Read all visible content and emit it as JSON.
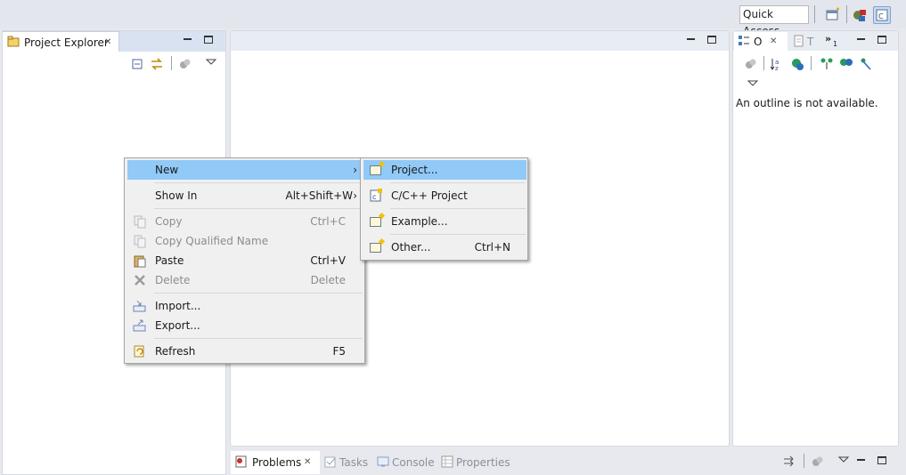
{
  "toolbar": {
    "quick_access": "Quick Access",
    "icons": [
      "open-perspective-icon",
      "debug-perspective-icon",
      "cpp-perspective-icon"
    ]
  },
  "project_explorer": {
    "tab_label": "Project Explorer",
    "icons": [
      "collapse-all-icon",
      "link-with-editor-icon",
      "filters-icon",
      "view-menu-icon"
    ]
  },
  "outline": {
    "tab_short": "O",
    "tab2_short": "T",
    "overflow_count": "1",
    "message": "An outline is not available."
  },
  "bottom_tabs": {
    "problems": "Problems",
    "tasks": "Tasks",
    "console": "Console",
    "properties": "Properties"
  },
  "context_menu": {
    "items": [
      {
        "label": "New",
        "shortcut": "",
        "submenu": true,
        "highlighted": true,
        "enabled": true,
        "icon": ""
      },
      {
        "label": "Show In",
        "shortcut": "Alt+Shift+W",
        "submenu": true,
        "enabled": true,
        "icon": ""
      },
      {
        "label": "Copy",
        "shortcut": "Ctrl+C",
        "enabled": false,
        "icon": "copy-icon"
      },
      {
        "label": "Copy Qualified Name",
        "shortcut": "",
        "enabled": false,
        "icon": "copy-qualified-name-icon"
      },
      {
        "label": "Paste",
        "shortcut": "Ctrl+V",
        "enabled": true,
        "icon": "paste-icon"
      },
      {
        "label": "Delete",
        "shortcut": "Delete",
        "enabled": false,
        "icon": "delete-icon"
      },
      {
        "label": "Import...",
        "shortcut": "",
        "enabled": true,
        "icon": "import-icon"
      },
      {
        "label": "Export...",
        "shortcut": "",
        "enabled": true,
        "icon": "export-icon"
      },
      {
        "label": "Refresh",
        "shortcut": "F5",
        "enabled": true,
        "icon": "refresh-icon"
      }
    ]
  },
  "submenu": {
    "items": [
      {
        "label": "Project...",
        "shortcut": "",
        "highlighted": true,
        "icon": "new-project-icon"
      },
      {
        "label": "C/C++ Project",
        "shortcut": "",
        "icon": "cpp-project-icon"
      },
      {
        "label": "Example...",
        "shortcut": "",
        "icon": "new-example-icon"
      },
      {
        "label": "Other...",
        "shortcut": "Ctrl+N",
        "icon": "new-other-icon"
      }
    ]
  },
  "colors": {
    "highlight": "#91c9f7",
    "menu_bg": "#f0f0f0",
    "workbench_bg": "#e7e9ee"
  }
}
